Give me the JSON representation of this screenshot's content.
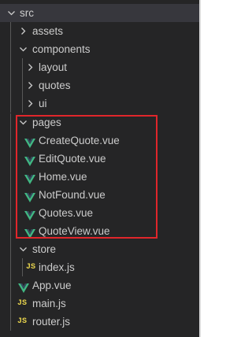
{
  "explorer": {
    "root_label": "src",
    "folders": {
      "assets": "assets",
      "components": "components",
      "layout": "layout",
      "quotes": "quotes",
      "ui": "ui",
      "pages": "pages",
      "store": "store"
    },
    "files": {
      "create_quote": "CreateQuote.vue",
      "edit_quote": "EditQuote.vue",
      "home": "Home.vue",
      "not_found": "NotFound.vue",
      "quotes": "Quotes.vue",
      "quote_view": "QuoteView.vue",
      "store_index": "index.js",
      "app": "App.vue",
      "main": "main.js",
      "router": "router.js"
    },
    "js_badge": "JS"
  },
  "colors": {
    "background": "#252526",
    "selected_row": "#37373d",
    "text": "#cccccc",
    "vue_green": "#41b883",
    "js_yellow": "#e8d44d",
    "highlight_red": "#e0262b"
  },
  "icons": {
    "expanded": "chevron-down-icon",
    "collapsed": "chevron-right-icon",
    "vue_file": "vue-file-icon",
    "js_file": "js-file-icon"
  }
}
